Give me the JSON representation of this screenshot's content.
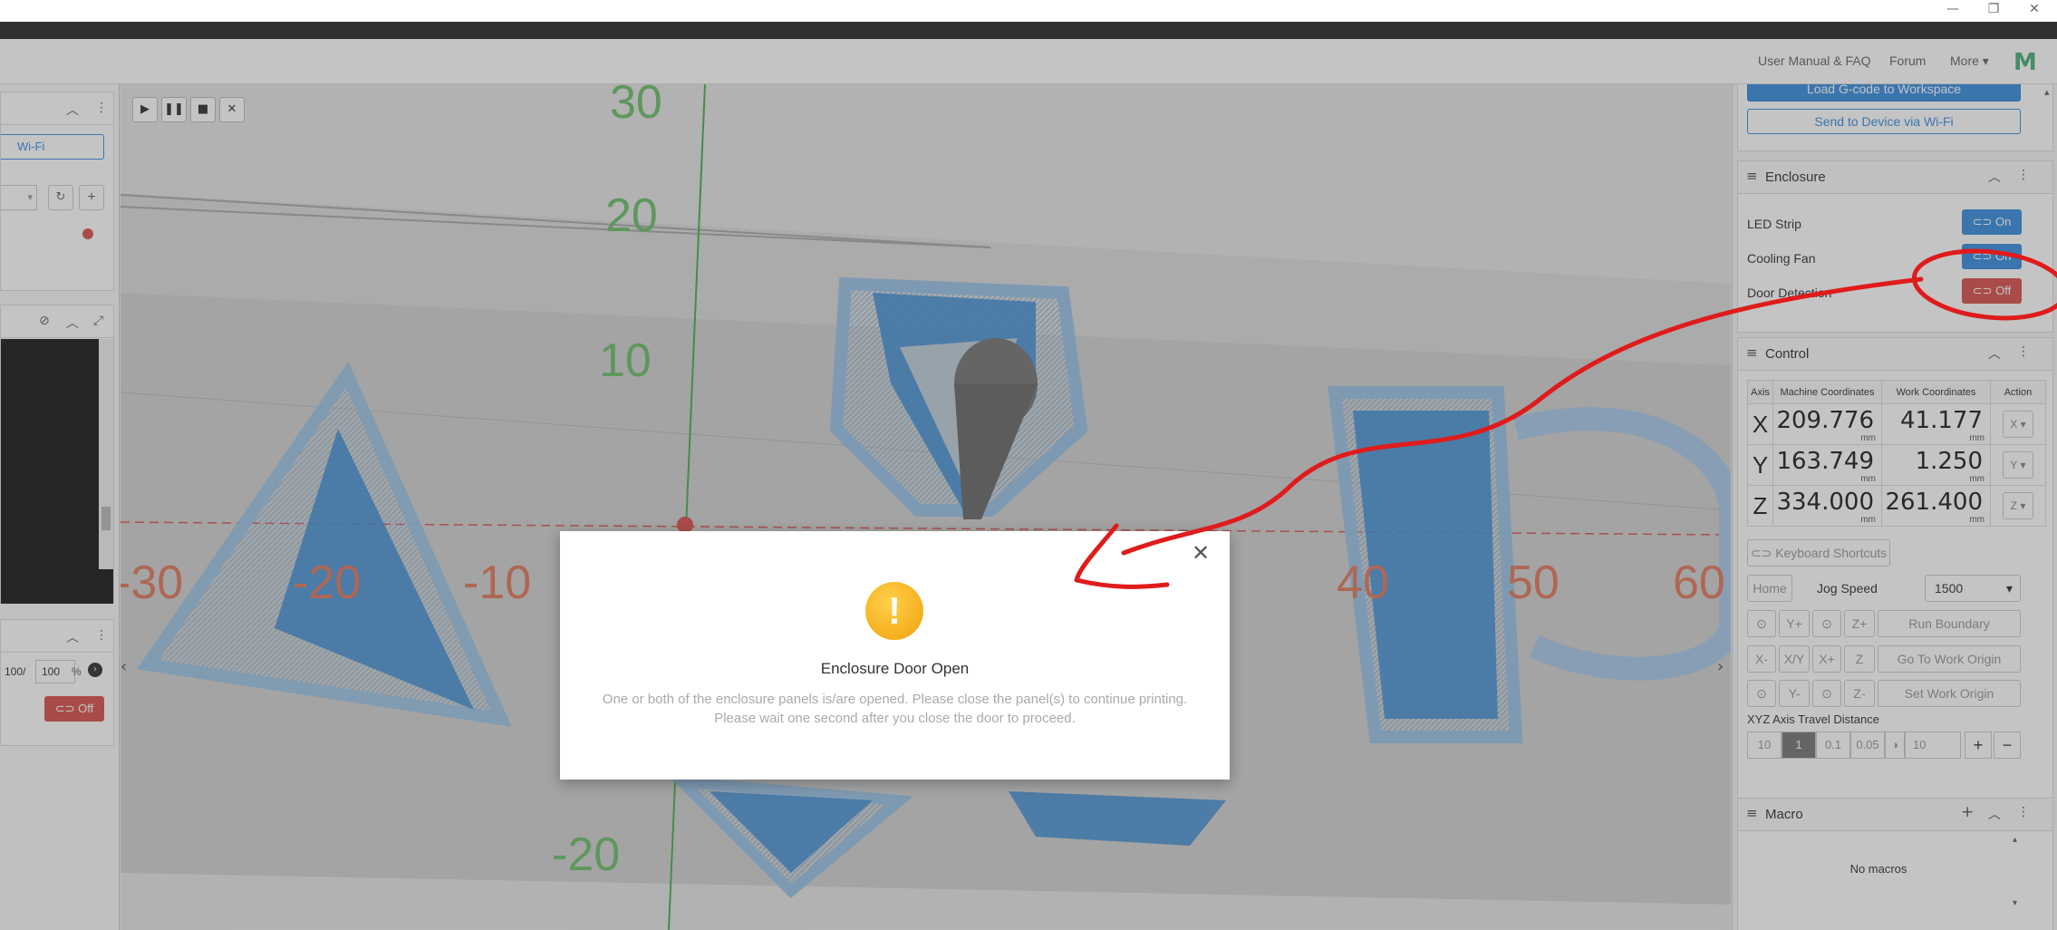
{
  "navbar": {
    "links": [
      "User Manual & FAQ",
      "Forum",
      "More"
    ]
  },
  "left_panel": {
    "wifi_label": "Wi-Fi",
    "percent_left": "100/",
    "percent_right": "100",
    "percent_sign": "%",
    "toggle_label": "Off"
  },
  "viewport": {
    "axis_labels_x": [
      "-30",
      "-20",
      "-10",
      "40",
      "50",
      "60"
    ],
    "axis_labels_y": [
      "30",
      "20",
      "10",
      "-20"
    ]
  },
  "workspace": {
    "load_label": "Load G-code to Workspace",
    "send_label": "Send to Device via Wi-Fi"
  },
  "enclosure": {
    "title": "Enclosure",
    "rows": [
      {
        "label": "LED Strip",
        "state": "On"
      },
      {
        "label": "Cooling Fan",
        "state": "On"
      },
      {
        "label": "Door Detection",
        "state": "Off"
      }
    ]
  },
  "control": {
    "title": "Control",
    "headers": [
      "Axis",
      "Machine Coordinates",
      "Work Coordinates",
      "Action"
    ],
    "axes": [
      {
        "axis": "X",
        "machine": "209.776",
        "work": "41.177",
        "unit": "mm",
        "action": "X"
      },
      {
        "axis": "Y",
        "machine": "163.749",
        "work": "1.250",
        "unit": "mm",
        "action": "Y"
      },
      {
        "axis": "Z",
        "machine": "334.000",
        "work": "261.400",
        "unit": "mm",
        "action": "Z"
      }
    ],
    "keyboard_shortcuts": "Keyboard Shortcuts",
    "home": "Home",
    "jog_speed_label": "Jog Speed",
    "jog_speed_value": "1500",
    "jog": {
      "y_plus": "Y+",
      "z_plus": "Z+",
      "run_boundary": "Run Boundary",
      "x_minus": "X-",
      "xy": "X/Y",
      "x_plus": "X+",
      "z": "Z",
      "go_to_origin": "Go To Work Origin",
      "y_minus": "Y-",
      "z_minus": "Z-",
      "set_origin": "Set Work Origin"
    },
    "travel_label": "XYZ Axis Travel Distance",
    "distances": [
      "10",
      "1",
      "0.1",
      "0.05"
    ],
    "custom_distance": "10"
  },
  "macro": {
    "title": "Macro",
    "empty": "No macros"
  },
  "modal": {
    "title": "Enclosure Door Open",
    "line1": "One or both of the enclosure panels is/are opened. Please close the panel(s) to continue printing.",
    "line2": "Please wait one second after you close the door to proceed."
  },
  "colors": {
    "accent": "#3a8fe0",
    "danger": "#d9534f",
    "annotation": "#e01b1b",
    "warning": "#f5a623"
  }
}
